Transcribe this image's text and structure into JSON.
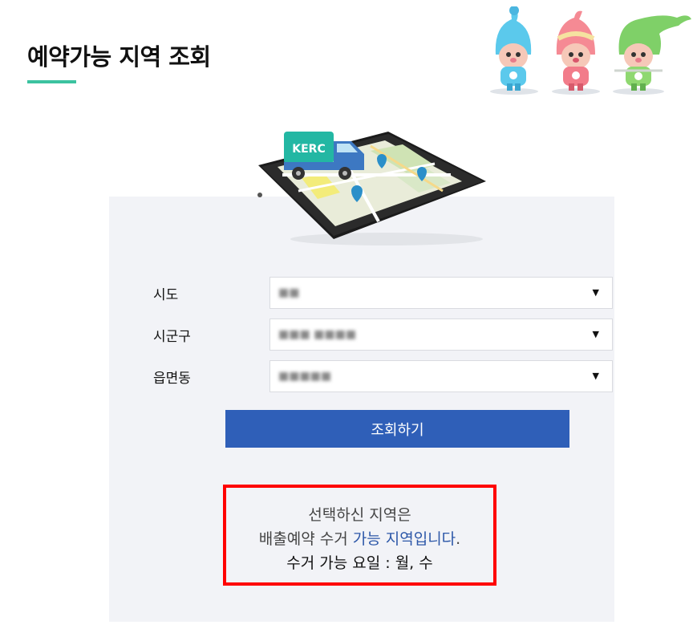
{
  "header": {
    "title": "예약가능 지역 조회"
  },
  "illustration": {
    "truck_label": "KERC"
  },
  "colors": {
    "accent": "#3cc3a0",
    "button": "#2f5fb8",
    "highlight": "#2c57a8",
    "result_border": "#ff0000",
    "panel_bg": "#f2f3f7"
  },
  "form": {
    "fields": [
      {
        "label": "시도",
        "value": "■■",
        "arrow": "▼"
      },
      {
        "label": "시군구",
        "value": "■■■ ■■■■",
        "arrow": "▼"
      },
      {
        "label": "읍면동",
        "value": "■■■■■",
        "arrow": "▼"
      }
    ],
    "submit_label": "조회하기"
  },
  "result": {
    "line1": "선택하신 지역은",
    "line2_prefix": "배출예약 수거 ",
    "line2_highlight": "가능 지역입니다",
    "line2_suffix": ".",
    "line3": "수거 가능 요일 : 월, 수"
  }
}
